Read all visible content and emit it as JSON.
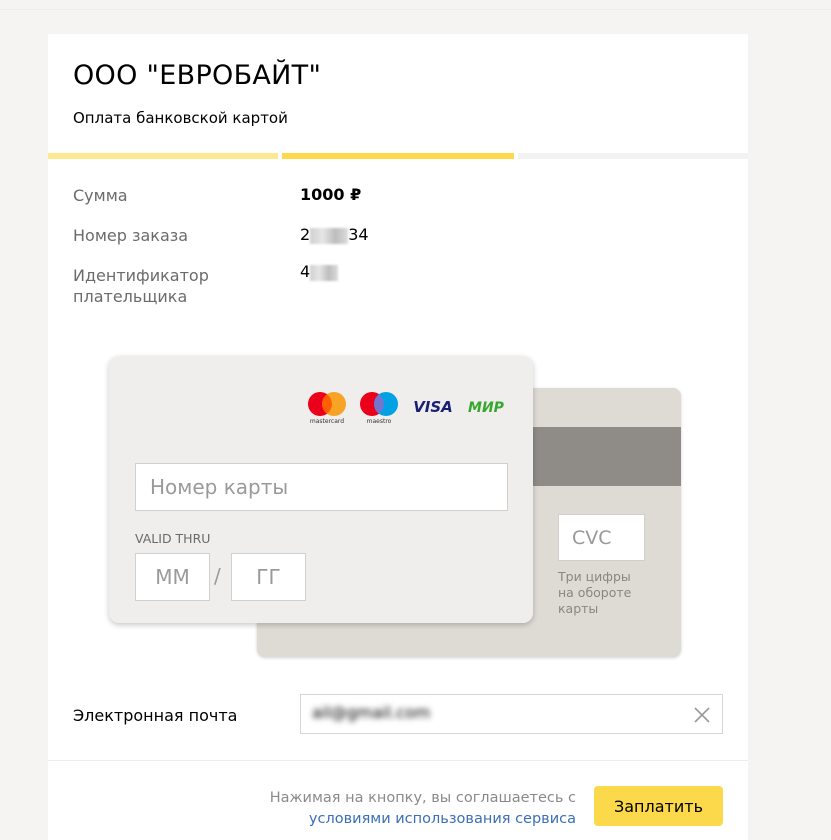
{
  "merchant": {
    "name": "ООО \"ЕВРОБАЙТ\"",
    "subtitle": "Оплата банковской картой"
  },
  "progress": {
    "steps": 3,
    "current_step": 2
  },
  "order": {
    "amount_label": "Сумма",
    "amount_value": "1000 ₽",
    "order_number_label": "Номер заказа",
    "order_number_visible_prefix": "2",
    "order_number_visible_suffix": "34",
    "payer_id_label": "Идентификатор плательщика",
    "payer_id_visible_prefix": "4"
  },
  "card": {
    "brand_icons": [
      "mastercard-icon",
      "maestro-icon",
      "visa-icon",
      "mir-icon"
    ],
    "brand_labels": {
      "mastercard": "mastercard",
      "maestro": "maestro",
      "visa": "VISA",
      "mir": "МИР"
    },
    "number_placeholder": "Номер карты",
    "valid_thru_label": "VALID THRU",
    "month_placeholder": "ММ",
    "year_placeholder": "ГГ",
    "slash": "/",
    "cvc_placeholder": "CVC",
    "cvc_hint": "Три цифры на обороте карты"
  },
  "email": {
    "label": "Электронная почта",
    "value_visible": "ail@gmail.com"
  },
  "footer": {
    "agree_text": "Нажимая на кнопку, вы соглашаетесь с",
    "agree_link": "условиями использования сервиса",
    "pay_button": "Заплатить"
  },
  "colors": {
    "accent_yellow": "#fcd94a",
    "accent_yellow_light": "#fde98f",
    "link_blue": "#3b6fb6",
    "mastercard_red": "#eb001b",
    "mastercard_orange": "#f79e1b",
    "maestro_blue": "#00a2e5",
    "visa_blue": "#1a1f71",
    "mir_green": "#37a72e"
  }
}
